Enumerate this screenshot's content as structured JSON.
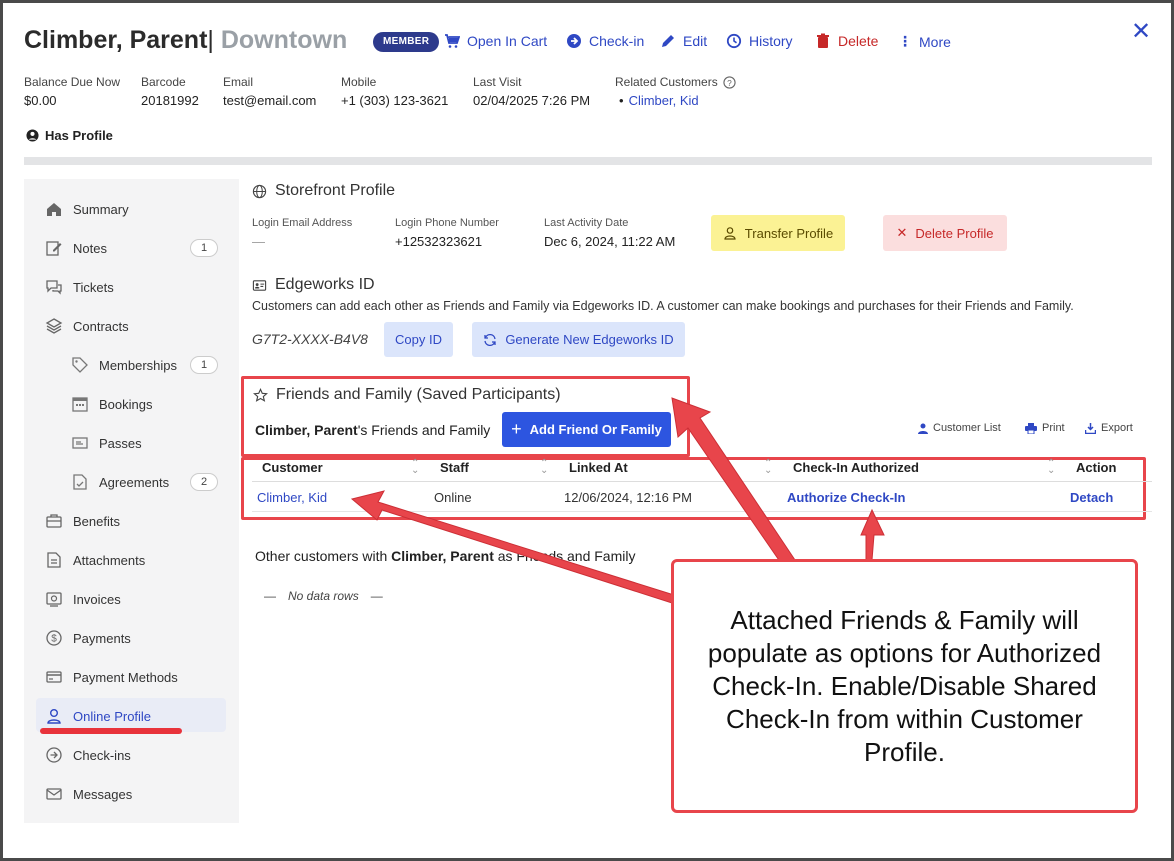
{
  "header": {
    "name": "Climber, Parent",
    "separator": "|",
    "location": "Downtown",
    "badge": "MEMBER",
    "actions": {
      "open_in_cart": "Open In Cart",
      "check_in": "Check-in",
      "edit": "Edit",
      "history": "History",
      "delete": "Delete",
      "more": "More"
    },
    "close": "✕"
  },
  "info": {
    "balance_label": "Balance Due Now",
    "balance_value": "$0.00",
    "barcode_label": "Barcode",
    "barcode_value": "20181992",
    "email_label": "Email",
    "email_value": "test@email.com",
    "mobile_label": "Mobile",
    "mobile_value": "+1 (303) 123-3621",
    "last_visit_label": "Last Visit",
    "last_visit_value": "02/04/2025 7:26 PM",
    "related_label": "Related Customers",
    "related_bullet": "•",
    "related_value": "Climber, Kid",
    "has_profile": "Has Profile"
  },
  "sidebar": {
    "summary": "Summary",
    "notes": "Notes",
    "notes_count": "1",
    "tickets": "Tickets",
    "contracts": "Contracts",
    "memberships": "Memberships",
    "memberships_count": "1",
    "bookings": "Bookings",
    "passes": "Passes",
    "agreements": "Agreements",
    "agreements_count": "2",
    "benefits": "Benefits",
    "attachments": "Attachments",
    "invoices": "Invoices",
    "payments": "Payments",
    "payment_methods": "Payment Methods",
    "online_profile": "Online Profile",
    "check_ins": "Check-ins",
    "messages": "Messages"
  },
  "storefront": {
    "title": "Storefront Profile",
    "login_email_label": "Login Email Address",
    "login_email_value": "—",
    "login_phone_label": "Login Phone Number",
    "login_phone_value": "+12532323621",
    "last_activity_label": "Last Activity Date",
    "last_activity_value": "Dec 6, 2024, 11:22 AM",
    "transfer_btn": "Transfer Profile",
    "delete_btn": "Delete Profile"
  },
  "edgeworks": {
    "title": "Edgeworks ID",
    "description": "Customers can add each other as Friends and Family via Edgeworks ID. A customer can make bookings and purchases for their Friends and Family.",
    "id_value": "G7T2-XXXX-B4V8",
    "copy_btn": "Copy ID",
    "generate_btn": "Generate New Edgeworks ID"
  },
  "friends": {
    "title": "Friends and Family (Saved Participants)",
    "owner_name": "Climber, Parent",
    "owner_suffix": "'s Friends and Family",
    "add_btn": "Add Friend Or Family",
    "tools": {
      "customer_list": "Customer List",
      "print": "Print",
      "export": "Export"
    },
    "columns": [
      "Customer",
      "Staff",
      "Linked At",
      "Check-In Authorized",
      "Action"
    ],
    "row": {
      "customer": "Climber, Kid",
      "staff": "Online",
      "linked_at": "12/06/2024, 12:16 PM",
      "authorize": "Authorize Check-In",
      "action": "Detach"
    },
    "other_prefix": "Other customers with ",
    "other_name": "Climber, Parent",
    "other_suffix": " as Friends and Family",
    "no_data": "No data rows",
    "dash": "—"
  },
  "callout": {
    "text": "Attached Friends & Family will populate as options for Authorized Check-In. Enable/Disable Shared Check-In from within Customer Profile."
  },
  "colors": {
    "accent": "#2f48c4",
    "primary_button": "#2d55e0",
    "danger": "#c62828",
    "annotation_red": "#e8454b",
    "badge": "#2d3a8c"
  }
}
